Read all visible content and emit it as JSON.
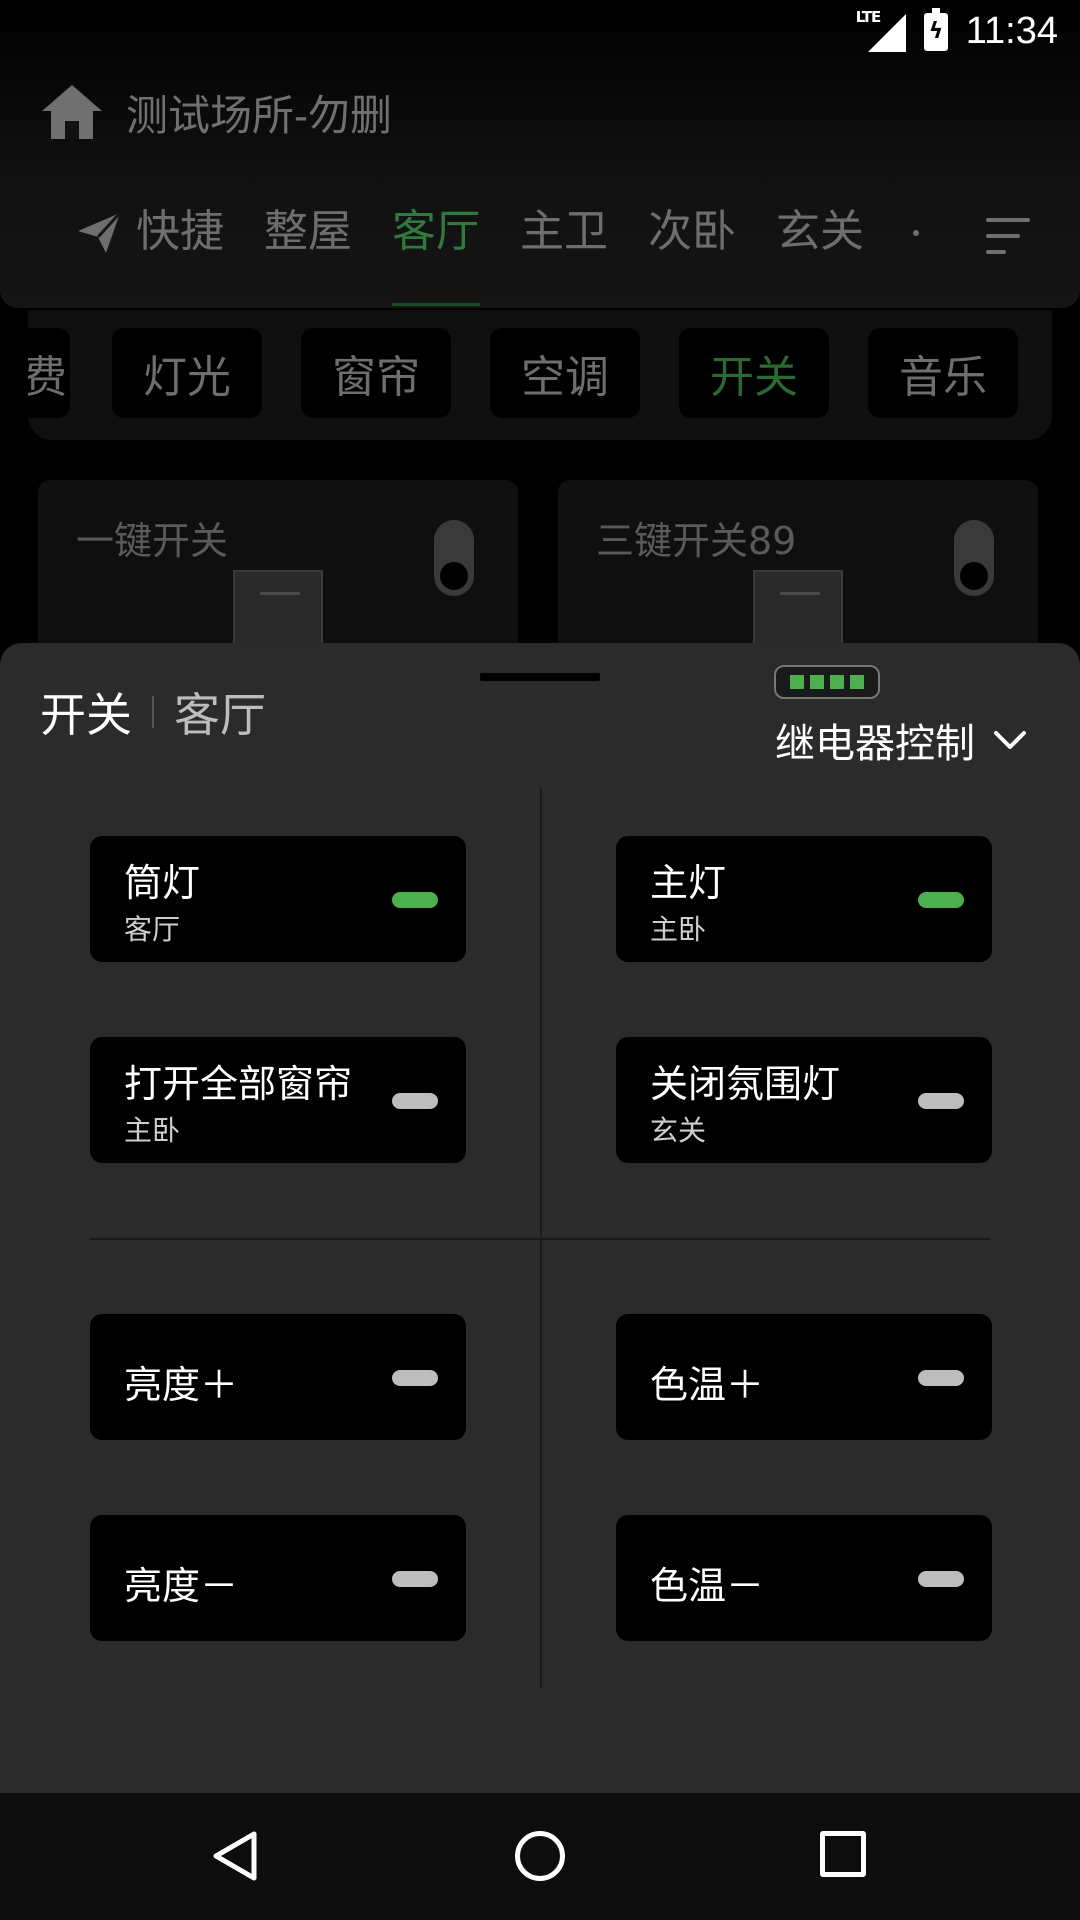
{
  "status_bar": {
    "network": "LTE",
    "time": "11:34"
  },
  "header": {
    "site_title": "测试场所-勿删",
    "rooms": [
      "快捷",
      "整屋",
      "客厅",
      "主卫",
      "次卧",
      "玄关"
    ],
    "active_room": "客厅"
  },
  "categories": {
    "partial": "费",
    "items": [
      "灯光",
      "窗帘",
      "空调",
      "开关",
      "音乐"
    ],
    "active": "开关"
  },
  "devices": [
    {
      "name": "一键开关"
    },
    {
      "name": "三键开关89"
    }
  ],
  "sheet": {
    "title": "开关",
    "room": "客厅",
    "mode_label": "继电器控制",
    "buttons": [
      {
        "title": "筒灯",
        "subtitle": "客厅",
        "on": true
      },
      {
        "title": "主灯",
        "subtitle": "主卧",
        "on": true
      },
      {
        "title": "打开全部窗帘",
        "subtitle": "主卧",
        "on": false
      },
      {
        "title": "关闭氛围灯",
        "subtitle": "玄关",
        "on": false
      },
      {
        "title": "亮度＋",
        "subtitle": "",
        "on": false
      },
      {
        "title": "色温＋",
        "subtitle": "",
        "on": false
      },
      {
        "title": "亮度－",
        "subtitle": "",
        "on": false
      },
      {
        "title": "色温－",
        "subtitle": "",
        "on": false
      }
    ]
  },
  "colors": {
    "accent_green": "#4caf50",
    "sheet_bg": "#2b2b2b",
    "button_bg": "#000000"
  }
}
